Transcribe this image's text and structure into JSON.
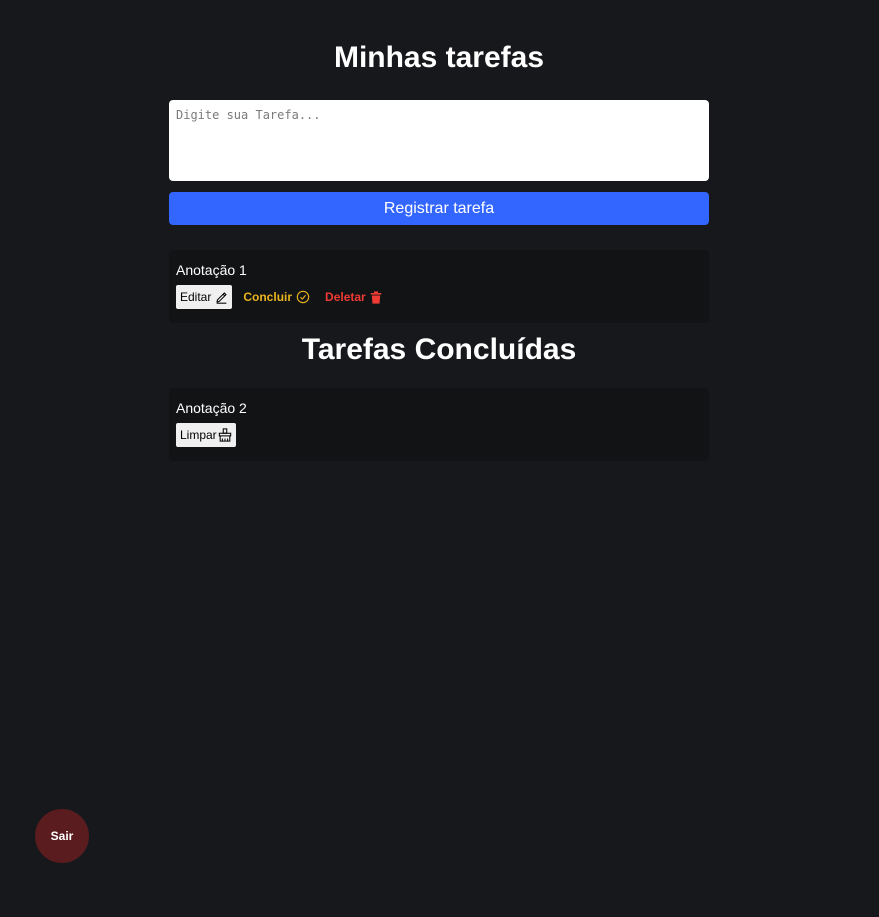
{
  "header": {
    "title": "Minhas tarefas"
  },
  "form": {
    "placeholder": "Digite sua Tarefa...",
    "value": "",
    "submit_label": "Registrar tarefa"
  },
  "tasks": [
    {
      "text": "Anotação 1",
      "edit_label": "Editar",
      "edit_icon": "pencil-icon",
      "conclude_label": "Concluir",
      "conclude_icon": "check-circle-icon",
      "delete_label": "Deletar",
      "delete_icon": "trash-icon"
    }
  ],
  "completed_section": {
    "title": "Tarefas Concluídas",
    "tasks": [
      {
        "text": "Anotação 2",
        "clear_label": "Limpar",
        "clear_icon": "broom-icon"
      }
    ]
  },
  "logout": {
    "label": "Sair"
  },
  "colors": {
    "background": "#17181c",
    "card": "#121315",
    "primary": "#3366ff",
    "conclude": "#e9b31f",
    "delete": "#ef3b34",
    "logout": "#5a1c1e"
  }
}
